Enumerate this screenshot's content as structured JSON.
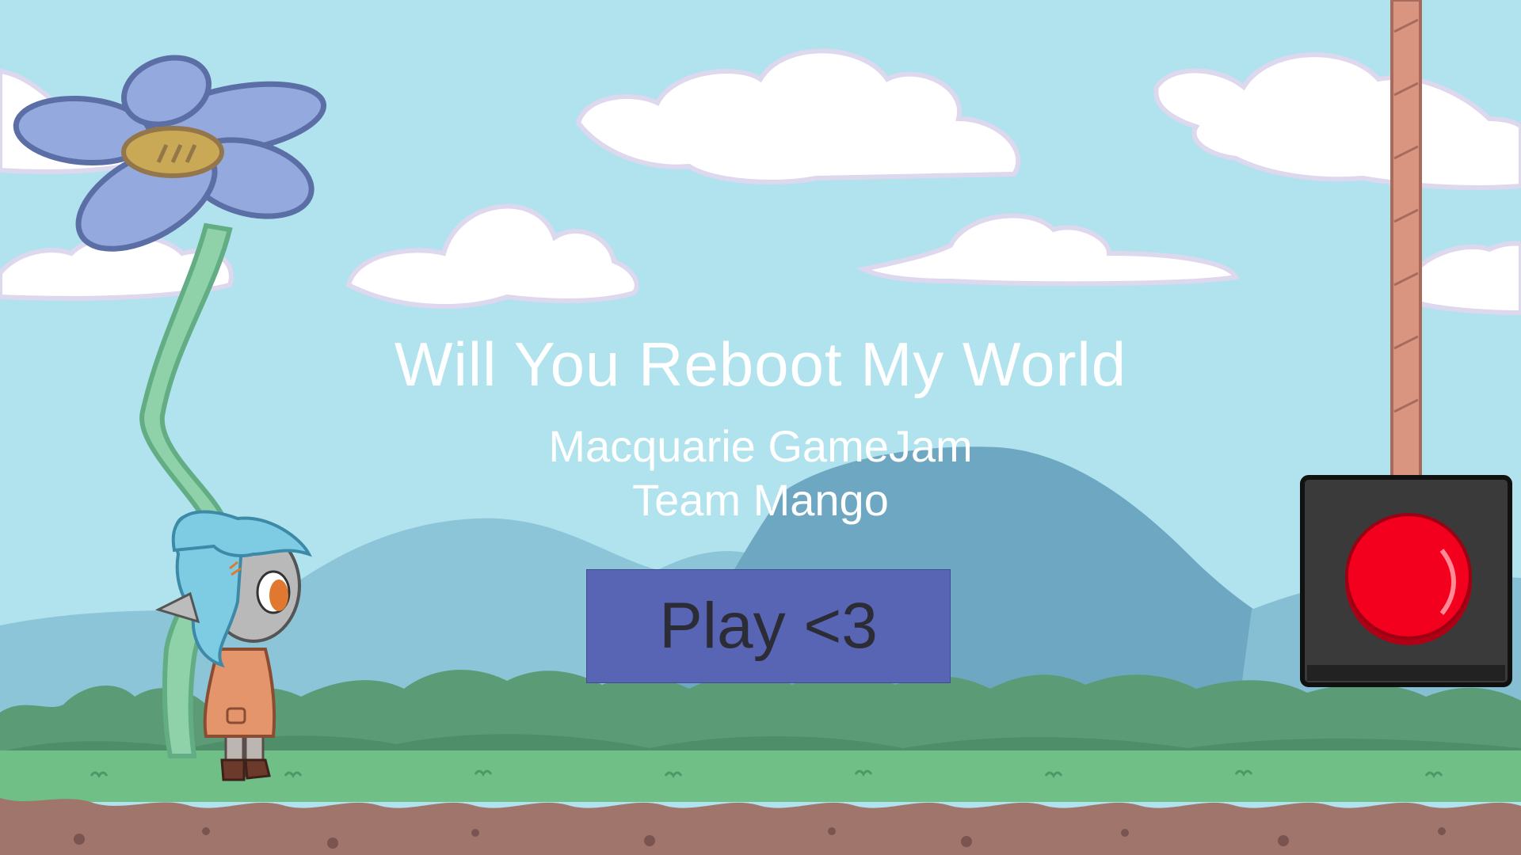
{
  "title": "Will You Reboot My World",
  "credits": {
    "event": "Macquarie GameJam",
    "team": "Team Mango"
  },
  "menu": {
    "play_label": "Play <3"
  },
  "colors": {
    "sky": "#b0e3ee",
    "button": "#5865b4",
    "button_text": "#2c2c36",
    "title_text": "#ffffff",
    "red_button": "#f2001d",
    "rope": "#d9957f",
    "grass": "#6fbf87",
    "dirt": "#a0756b"
  },
  "icons": {
    "flower": "flower-icon",
    "character": "character-icon",
    "reset_button": "big-red-button-icon"
  }
}
